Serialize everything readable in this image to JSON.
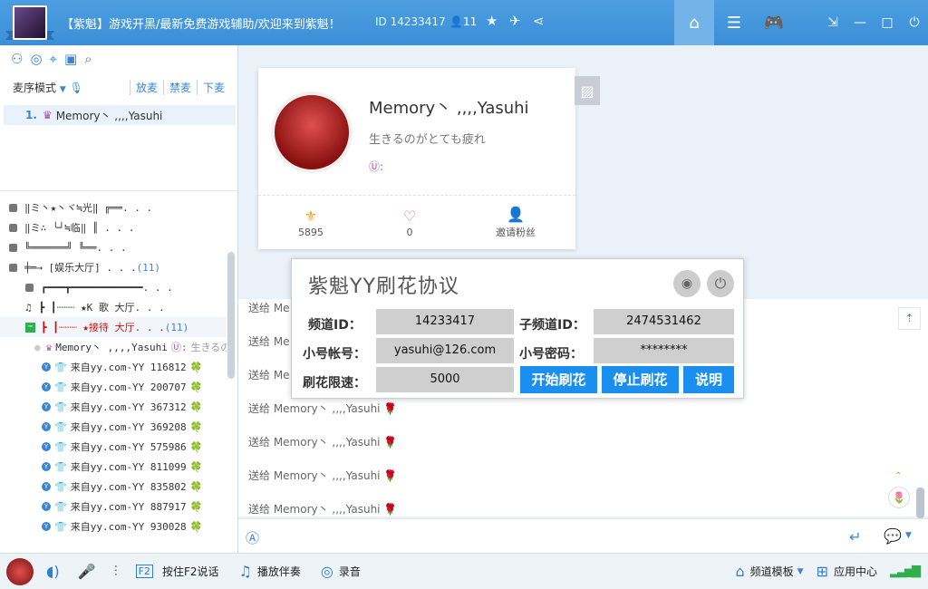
{
  "titlebar": {
    "title": "【紫魁】游戏开黑/最新免费游戏辅助/欢迎来到紫魁！",
    "id_label": "ID 14233417",
    "user_count": "11"
  },
  "left": {
    "mic_mode": "麦序模式",
    "actions": [
      "放麦",
      "禁麦",
      "下麦"
    ],
    "queue": {
      "num": "1.",
      "name": "Memory丶 ,,,,Yasuhi"
    },
    "tree": [
      {
        "type": "lock",
        "text": "‖ミ丶★丶ヾ≒光‖                ╔══. . ."
      },
      {
        "type": "lock",
        "text": "‖ミ∴  ╰┘≒临‖                ║      . . ."
      },
      {
        "type": "lock",
        "text": "╚══════╝              ╚══. . ."
      },
      {
        "type": "lock",
        "text": "╪═→             [娱乐大厅]  . . .",
        "count": "(11)"
      },
      {
        "type": "lock2",
        "text": "┏━━━┳━━━━━━━━━━━━. . ."
      },
      {
        "type": "music",
        "text": "┣          ┃┈┈┈  ★K 歌  大厅. . ."
      },
      {
        "type": "sel",
        "text": "┣          ┃┈┈┈  ★接待  大厅. . .",
        "count": "(11)"
      },
      {
        "type": "member",
        "text": "Memory丶 ,,,,Yasuhi",
        "sig": "生きるの"
      },
      {
        "type": "user",
        "text": "来自yy.com-YY 116812"
      },
      {
        "type": "user",
        "text": "来自yy.com-YY 200707"
      },
      {
        "type": "user",
        "text": "来自yy.com-YY 367312"
      },
      {
        "type": "user",
        "text": "来自yy.com-YY 369208"
      },
      {
        "type": "user",
        "text": "来自yy.com-YY 575986"
      },
      {
        "type": "user",
        "text": "来自yy.com-YY 811099"
      },
      {
        "type": "user",
        "text": "来自yy.com-YY 835802"
      },
      {
        "type": "user",
        "text": "来自yy.com-YY 887917"
      },
      {
        "type": "user",
        "text": "来自yy.com-YY 930028"
      }
    ]
  },
  "profile": {
    "name": "Memory丶 ,,,,Yasuhi",
    "signature": "生きるのがとても疲れ",
    "stats": [
      {
        "value": "5895"
      },
      {
        "value": "0"
      },
      {
        "value": "邀请粉丝"
      }
    ]
  },
  "chat": {
    "partial_prefix": "送给 Me",
    "messages": [
      "送给 Memory丶 ,,,,Yasuhi",
      "送给 Memory丶 ,,,,Yasuhi",
      "送给 Memory丶 ,,,,Yasuhi",
      "送给 Memory丶 ,,,,Yasuhi"
    ]
  },
  "dialog": {
    "title": "紫魁YY刷花协议",
    "channel_id_label": "频道ID：",
    "channel_id": "14233417",
    "sub_channel_label": "子频道ID：",
    "sub_channel_id": "2474531462",
    "account_label": "小号帐号：",
    "account": "yasuhi@126.com",
    "password_label": "小号密码：",
    "password": "********",
    "speed_label": "刷花限速：",
    "speed": "5000",
    "start_label": "开始刷花",
    "stop_label": "停止刷花",
    "help_label": "说明"
  },
  "bottom": {
    "f2": "按住F2说话",
    "music": "播放伴奏",
    "record": "录音",
    "template": "频道模板",
    "app_center": "应用中心"
  }
}
